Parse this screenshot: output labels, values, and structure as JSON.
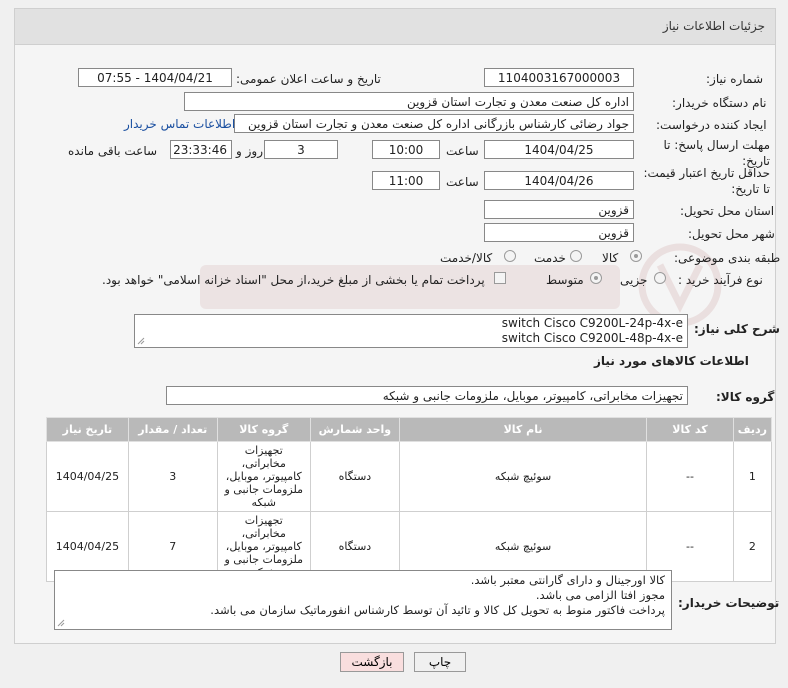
{
  "header": {
    "title": "جزئیات اطلاعات نیاز"
  },
  "fields": {
    "need_number_label": "شماره نیاز:",
    "need_number": "1104003167000003",
    "announce_label": "تاریخ و ساعت اعلان عمومی:",
    "announce_value": "1404/04/21 - 07:55",
    "buyer_org_label": "نام دستگاه خریدار:",
    "buyer_org": "اداره کل صنعت  معدن و تجارت استان قزوین",
    "requester_label": "ایجاد کننده درخواست:",
    "requester": "جواد رضائی کارشناس بازرگانی اداره کل صنعت  معدن و تجارت استان قزوین",
    "contact_link": "اطلاعات تماس خریدار",
    "deadline_label": "مهلت ارسال پاسخ: تا تاریخ:",
    "deadline_date": "1404/04/25",
    "time_label": "ساعت",
    "deadline_time": "10:00",
    "days_value": "3",
    "days_label": "روز و",
    "remaining_time": "23:33:46",
    "remaining_label": "ساعت باقی مانده",
    "validity_label": "حداقل تاریخ اعتبار قیمت: تا تاریخ:",
    "validity_date": "1404/04/26",
    "validity_time": "11:00",
    "province_label": "استان محل تحویل:",
    "province": "قزوین",
    "city_label": "شهر محل تحویل:",
    "city": "قزوین",
    "category_label": "طبقه بندی موضوعی:",
    "category_options": [
      "کالا",
      "خدمت",
      "کالا/خدمت"
    ],
    "process_label": "نوع فرآیند خرید :",
    "process_options": [
      "جزیی",
      "متوسط"
    ],
    "payment_note": "پرداخت تمام یا بخشی از مبلغ خرید،از محل \"اسناد خزانه اسلامی\" خواهد بود."
  },
  "description": {
    "label": "شرح کلی نیاز:",
    "lines": [
      "switch Cisco C9200L-24p-4x-e",
      "switch Cisco C9200L-48p-4x-e"
    ]
  },
  "goods_section": {
    "title": "اطلاعات کالاهای مورد نیاز",
    "group_label": "گروه کالا:",
    "group_value": "تجهیزات مخابراتی، کامپیوتر، موبایل، ملزومات جانبی و شبکه"
  },
  "table": {
    "headers": [
      "ردیف",
      "کد کالا",
      "نام کالا",
      "واحد شمارش",
      "گروه کالا",
      "تعداد / مقدار",
      "تاریخ نیاز"
    ],
    "rows": [
      [
        "1",
        "--",
        "سوئیچ شبکه",
        "دستگاه",
        "تجهیزات مخابراتی، کامپیوتر، موبایل، ملزومات جانبی و شبکه",
        "3",
        "1404/04/25"
      ],
      [
        "2",
        "--",
        "سوئیچ شبکه",
        "دستگاه",
        "تجهیزات مخابراتی، کامپیوتر، موبایل، ملزومات جانبی و شبکه",
        "7",
        "1404/04/25"
      ]
    ]
  },
  "buyer_notes": {
    "label": "توضیحات خریدار:",
    "lines": [
      "کالا اورجینال و دارای گارانتی معتبر باشد.",
      "مجوز افتا الزامی می باشد.",
      "پرداخت فاکتور منوط به تحویل کل کالا و تائید آن توسط کارشناس انفورماتیک سازمان می باشد."
    ]
  },
  "buttons": {
    "print": "چاپ",
    "back": "بازگشت"
  },
  "colors": {
    "header_bg": "#e1e1e1",
    "table_header": "#b9b9b9",
    "link": "#1a4fa0",
    "back_button": "#f9dede"
  }
}
